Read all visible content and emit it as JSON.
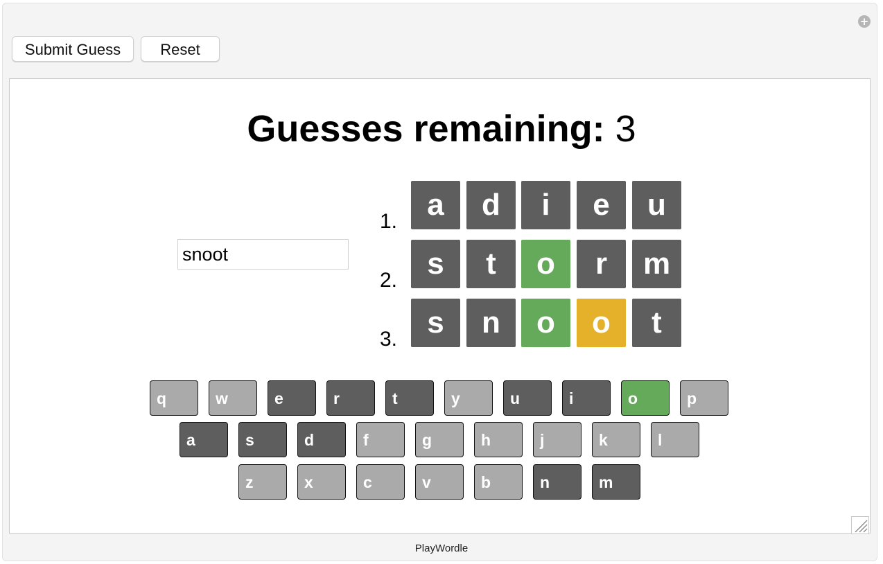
{
  "app": {
    "footer": "PlayWordle",
    "expand_icon": "plus-circle-icon",
    "resize_icon": "resize-grip-icon"
  },
  "toolbar": {
    "submit_label": "Submit Guess",
    "reset_label": "Reset"
  },
  "status": {
    "label": "Guesses remaining:",
    "value": "3"
  },
  "input": {
    "value": "snoot"
  },
  "colors": {
    "absent": "#5e5e5e",
    "correct": "#65a95a",
    "present": "#e6b12a",
    "unused": "#aaaaaa"
  },
  "guesses": [
    {
      "number": "1.",
      "letters": [
        {
          "letter": "a",
          "state": "absent"
        },
        {
          "letter": "d",
          "state": "absent"
        },
        {
          "letter": "i",
          "state": "absent"
        },
        {
          "letter": "e",
          "state": "absent"
        },
        {
          "letter": "u",
          "state": "absent"
        }
      ]
    },
    {
      "number": "2.",
      "letters": [
        {
          "letter": "s",
          "state": "absent"
        },
        {
          "letter": "t",
          "state": "absent"
        },
        {
          "letter": "o",
          "state": "correct"
        },
        {
          "letter": "r",
          "state": "absent"
        },
        {
          "letter": "m",
          "state": "absent"
        }
      ]
    },
    {
      "number": "3.",
      "letters": [
        {
          "letter": "s",
          "state": "absent"
        },
        {
          "letter": "n",
          "state": "absent"
        },
        {
          "letter": "o",
          "state": "correct"
        },
        {
          "letter": "o",
          "state": "present"
        },
        {
          "letter": "t",
          "state": "absent"
        }
      ]
    }
  ],
  "keyboard": [
    [
      {
        "key": "q",
        "state": "unused"
      },
      {
        "key": "w",
        "state": "unused"
      },
      {
        "key": "e",
        "state": "absent"
      },
      {
        "key": "r",
        "state": "absent"
      },
      {
        "key": "t",
        "state": "absent"
      },
      {
        "key": "y",
        "state": "unused"
      },
      {
        "key": "u",
        "state": "absent"
      },
      {
        "key": "i",
        "state": "absent"
      },
      {
        "key": "o",
        "state": "correct"
      },
      {
        "key": "p",
        "state": "unused"
      }
    ],
    [
      {
        "key": "a",
        "state": "absent"
      },
      {
        "key": "s",
        "state": "absent"
      },
      {
        "key": "d",
        "state": "absent"
      },
      {
        "key": "f",
        "state": "unused"
      },
      {
        "key": "g",
        "state": "unused"
      },
      {
        "key": "h",
        "state": "unused"
      },
      {
        "key": "j",
        "state": "unused"
      },
      {
        "key": "k",
        "state": "unused"
      },
      {
        "key": "l",
        "state": "unused"
      }
    ],
    [
      {
        "key": "z",
        "state": "unused"
      },
      {
        "key": "x",
        "state": "unused"
      },
      {
        "key": "c",
        "state": "unused"
      },
      {
        "key": "v",
        "state": "unused"
      },
      {
        "key": "b",
        "state": "unused"
      },
      {
        "key": "n",
        "state": "absent"
      },
      {
        "key": "m",
        "state": "absent"
      }
    ]
  ]
}
